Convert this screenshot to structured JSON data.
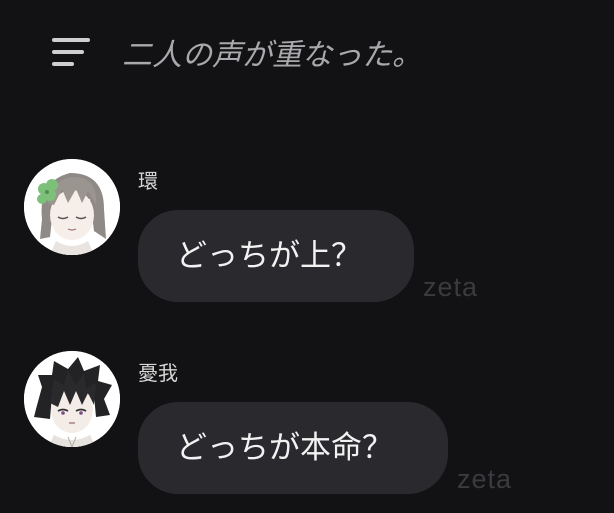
{
  "header": {
    "menu_icon": "hamburger-menu-icon",
    "title": "二人の声が重なった。"
  },
  "messages": [
    {
      "sender": "環",
      "text": "どっちが上？",
      "watermark": "zeta",
      "avatar": "avatar-tamaki"
    },
    {
      "sender": "憂我",
      "text": "どっちが本命？",
      "watermark": "zeta",
      "avatar": "avatar-yuuga"
    }
  ],
  "colors": {
    "background": "#121214",
    "bubble": "#2a2a2e",
    "text": "#f2f2f2",
    "title": "#a9a9ad",
    "watermark": "#3b3b3f"
  }
}
